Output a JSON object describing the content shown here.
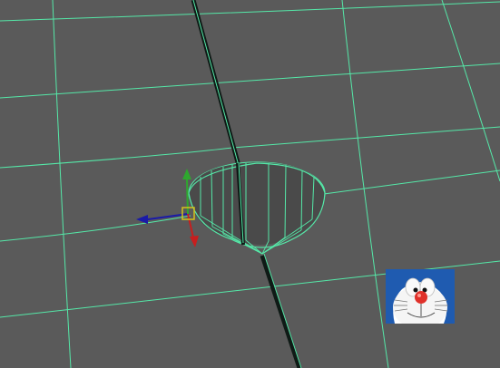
{
  "viewport": {
    "background": "#5a5a5a",
    "wire_color": "#55e8a8",
    "hole_wall_color": "#4a4a4a",
    "hole_face_color": "#676767"
  },
  "manipulator": {
    "x_axis_color": "#1a1aa8",
    "y_axis_color": "#2ea82e",
    "z_axis_color": "#c81e1e",
    "pivot_color": "#d6c21a"
  },
  "thumbnail": {
    "icon": "doraemon-face-icon",
    "face_color": "#1f5bb0",
    "nose_color": "#e0312a"
  }
}
